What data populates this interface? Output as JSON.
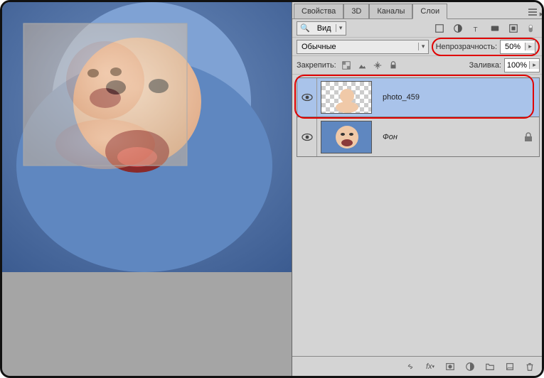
{
  "tabs": {
    "properties": "Свойства",
    "threeD": "3D",
    "channels": "Каналы",
    "layers": "Слои"
  },
  "filterRow": {
    "kindLabel": "Вид"
  },
  "blendRow": {
    "mode": "Обычные",
    "opacityLabel": "Непрозрачность:",
    "opacityValue": "50%"
  },
  "lockRow": {
    "lockLabel": "Закрепить:",
    "fillLabel": "Заливка:",
    "fillValue": "100%"
  },
  "layers": [
    {
      "name": "photo_459",
      "selected": true,
      "locked": false
    },
    {
      "name": "Фон",
      "selected": false,
      "locked": true
    }
  ]
}
